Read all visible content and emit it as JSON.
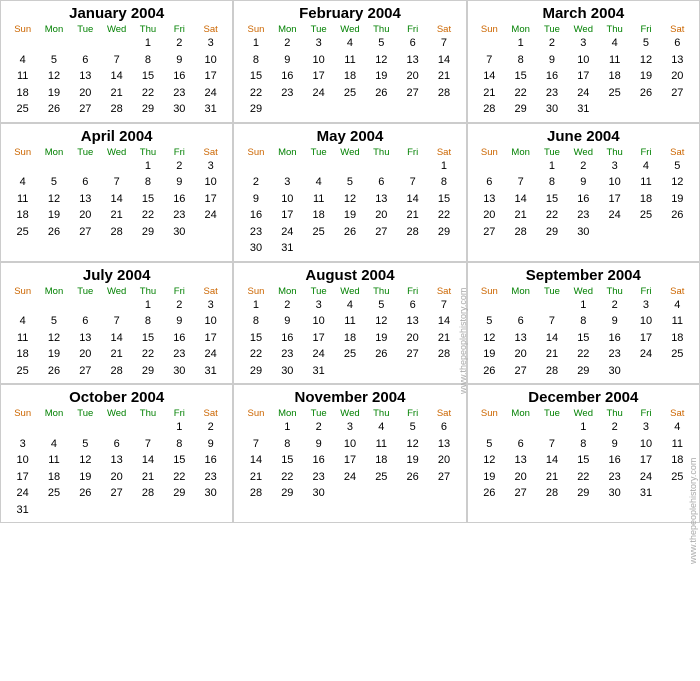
{
  "calendar": {
    "year": 2004,
    "months": [
      {
        "name": "January 2004",
        "startDay": 4,
        "days": 31,
        "weeks": [
          [
            "",
            "",
            "",
            "",
            "1",
            "2",
            "3"
          ],
          [
            "4",
            "5",
            "6",
            "7",
            "8",
            "9",
            "10"
          ],
          [
            "11",
            "12",
            "13",
            "14",
            "15",
            "16",
            "17"
          ],
          [
            "18",
            "19",
            "20",
            "21",
            "22",
            "23",
            "24"
          ],
          [
            "25",
            "26",
            "27",
            "28",
            "29",
            "30",
            "31"
          ]
        ]
      },
      {
        "name": "February 2004",
        "startDay": 0,
        "days": 29,
        "weeks": [
          [
            "1",
            "2",
            "3",
            "4",
            "5",
            "6",
            "7"
          ],
          [
            "8",
            "9",
            "10",
            "11",
            "12",
            "13",
            "14"
          ],
          [
            "15",
            "16",
            "17",
            "18",
            "19",
            "20",
            "21"
          ],
          [
            "22",
            "23",
            "24",
            "25",
            "26",
            "27",
            "28"
          ],
          [
            "29",
            "",
            "",
            "",
            "",
            "",
            ""
          ]
        ]
      },
      {
        "name": "March 2004",
        "startDay": 1,
        "days": 31,
        "weeks": [
          [
            "",
            "1",
            "2",
            "3",
            "4",
            "5",
            "6"
          ],
          [
            "7",
            "8",
            "9",
            "10",
            "11",
            "12",
            "13"
          ],
          [
            "14",
            "15",
            "16",
            "17",
            "18",
            "19",
            "20"
          ],
          [
            "21",
            "22",
            "23",
            "24",
            "25",
            "26",
            "27"
          ],
          [
            "28",
            "29",
            "30",
            "31",
            "",
            "",
            ""
          ]
        ]
      },
      {
        "name": "April 2004",
        "startDay": 4,
        "days": 30,
        "weeks": [
          [
            "",
            "",
            "",
            "",
            "1",
            "2",
            "3"
          ],
          [
            "4",
            "5",
            "6",
            "7",
            "8",
            "9",
            "10"
          ],
          [
            "11",
            "12",
            "13",
            "14",
            "15",
            "16",
            "17"
          ],
          [
            "18",
            "19",
            "20",
            "21",
            "22",
            "23",
            "24"
          ],
          [
            "25",
            "26",
            "27",
            "28",
            "29",
            "30",
            ""
          ]
        ]
      },
      {
        "name": "May 2004",
        "startDay": 6,
        "days": 31,
        "weeks": [
          [
            "",
            "",
            "",
            "",
            "",
            "",
            "1"
          ],
          [
            "2",
            "3",
            "4",
            "5",
            "6",
            "7",
            "8"
          ],
          [
            "9",
            "10",
            "11",
            "12",
            "13",
            "14",
            "15"
          ],
          [
            "16",
            "17",
            "18",
            "19",
            "20",
            "21",
            "22"
          ],
          [
            "23",
            "24",
            "25",
            "26",
            "27",
            "28",
            "29"
          ],
          [
            "30",
            "31",
            "",
            "",
            "",
            "",
            ""
          ]
        ]
      },
      {
        "name": "June 2004",
        "startDay": 2,
        "days": 30,
        "weeks": [
          [
            "",
            "",
            "1",
            "2",
            "3",
            "4",
            "5"
          ],
          [
            "6",
            "7",
            "8",
            "9",
            "10",
            "11",
            "12"
          ],
          [
            "13",
            "14",
            "15",
            "16",
            "17",
            "18",
            "19"
          ],
          [
            "20",
            "21",
            "22",
            "23",
            "24",
            "25",
            "26"
          ],
          [
            "27",
            "28",
            "29",
            "30",
            "",
            "",
            ""
          ]
        ]
      },
      {
        "name": "July 2004",
        "startDay": 4,
        "days": 31,
        "weeks": [
          [
            "",
            "",
            "",
            "",
            "1",
            "2",
            "3"
          ],
          [
            "4",
            "5",
            "6",
            "7",
            "8",
            "9",
            "10"
          ],
          [
            "11",
            "12",
            "13",
            "14",
            "15",
            "16",
            "17"
          ],
          [
            "18",
            "19",
            "20",
            "21",
            "22",
            "23",
            "24"
          ],
          [
            "25",
            "26",
            "27",
            "28",
            "29",
            "30",
            "31"
          ]
        ]
      },
      {
        "name": "August 2004",
        "startDay": 0,
        "days": 31,
        "weeks": [
          [
            "1",
            "2",
            "3",
            "4",
            "5",
            "6",
            "7"
          ],
          [
            "8",
            "9",
            "10",
            "11",
            "12",
            "13",
            "14"
          ],
          [
            "15",
            "16",
            "17",
            "18",
            "19",
            "20",
            "21"
          ],
          [
            "22",
            "23",
            "24",
            "25",
            "26",
            "27",
            "28"
          ],
          [
            "29",
            "30",
            "31",
            "",
            "",
            "",
            ""
          ]
        ]
      },
      {
        "name": "September 2004",
        "startDay": 3,
        "days": 30,
        "weeks": [
          [
            "",
            "",
            "",
            "1",
            "2",
            "3",
            "4"
          ],
          [
            "5",
            "6",
            "7",
            "8",
            "9",
            "10",
            "11"
          ],
          [
            "12",
            "13",
            "14",
            "15",
            "16",
            "17",
            "18"
          ],
          [
            "19",
            "20",
            "21",
            "22",
            "23",
            "24",
            "25"
          ],
          [
            "26",
            "27",
            "28",
            "29",
            "30",
            "",
            ""
          ]
        ]
      },
      {
        "name": "October 2004",
        "startDay": 5,
        "days": 31,
        "weeks": [
          [
            "",
            "",
            "",
            "",
            "",
            "1",
            "2"
          ],
          [
            "3",
            "4",
            "5",
            "6",
            "7",
            "8",
            "9"
          ],
          [
            "10",
            "11",
            "12",
            "13",
            "14",
            "15",
            "16"
          ],
          [
            "17",
            "18",
            "19",
            "20",
            "21",
            "22",
            "23"
          ],
          [
            "24",
            "25",
            "26",
            "27",
            "28",
            "29",
            "30"
          ],
          [
            "31",
            "",
            "",
            "",
            "",
            "",
            ""
          ]
        ]
      },
      {
        "name": "November 2004",
        "startDay": 1,
        "days": 30,
        "weeks": [
          [
            "",
            "1",
            "2",
            "3",
            "4",
            "5",
            "6"
          ],
          [
            "7",
            "8",
            "9",
            "10",
            "11",
            "12",
            "13"
          ],
          [
            "14",
            "15",
            "16",
            "17",
            "18",
            "19",
            "20"
          ],
          [
            "21",
            "22",
            "23",
            "24",
            "25",
            "26",
            "27"
          ],
          [
            "28",
            "29",
            "30",
            "",
            "",
            "",
            ""
          ]
        ]
      },
      {
        "name": "December 2004",
        "startDay": 3,
        "days": 31,
        "weeks": [
          [
            "",
            "",
            "",
            "1",
            "2",
            "3",
            "4"
          ],
          [
            "5",
            "6",
            "7",
            "8",
            "9",
            "10",
            "11"
          ],
          [
            "12",
            "13",
            "14",
            "15",
            "16",
            "17",
            "18"
          ],
          [
            "19",
            "20",
            "21",
            "22",
            "23",
            "24",
            "25"
          ],
          [
            "26",
            "27",
            "28",
            "29",
            "30",
            "31",
            ""
          ]
        ]
      }
    ],
    "dayHeaders": [
      "Sun",
      "Mon",
      "Tue",
      "Wed",
      "Thu",
      "Fri",
      "Sat"
    ],
    "watermark": "www.thepeoplehistory.com"
  }
}
